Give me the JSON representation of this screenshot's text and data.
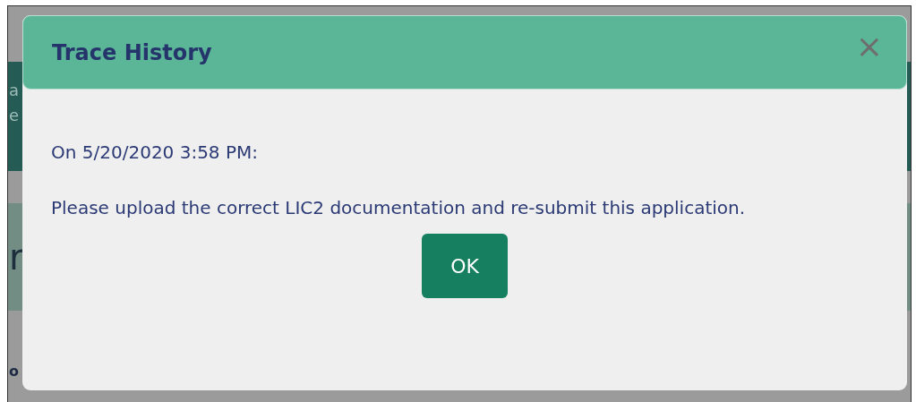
{
  "background": {
    "banner_lines": [
      "a",
      "e"
    ],
    "heading": "r",
    "label": "o"
  },
  "modal": {
    "title": "Trace History",
    "close": "×",
    "timestamp": "On 5/20/2020 3:58 PM:",
    "message": "Please upload the correct LIC2 documentation and re-submit this application.",
    "buttons": [
      "OK"
    ]
  }
}
